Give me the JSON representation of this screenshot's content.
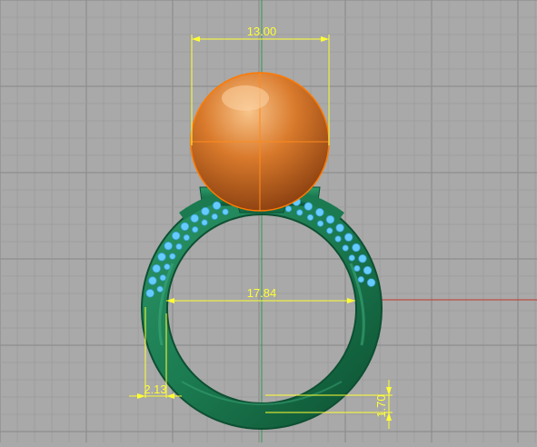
{
  "viewport": {
    "background": "#a9a9a9",
    "grid_minor_color": "#9b9b9b",
    "grid_major_color": "#8e8e8e"
  },
  "colors": {
    "dimension": "#ffff33",
    "pearl": "#d9772a",
    "pearl_highlight": "#f7b878",
    "pearl_outline": "#ff7a00",
    "band": "#1b7a50",
    "band_dark": "#0f5a38",
    "stones": "#66ccff",
    "axis_x": "#c0392b",
    "axis_y": "#2e9b4e"
  },
  "dimensions": {
    "pearl_diameter": "13.00",
    "inner_diameter": "17.84",
    "band_width": "2.13",
    "band_thickness": "1.70"
  }
}
